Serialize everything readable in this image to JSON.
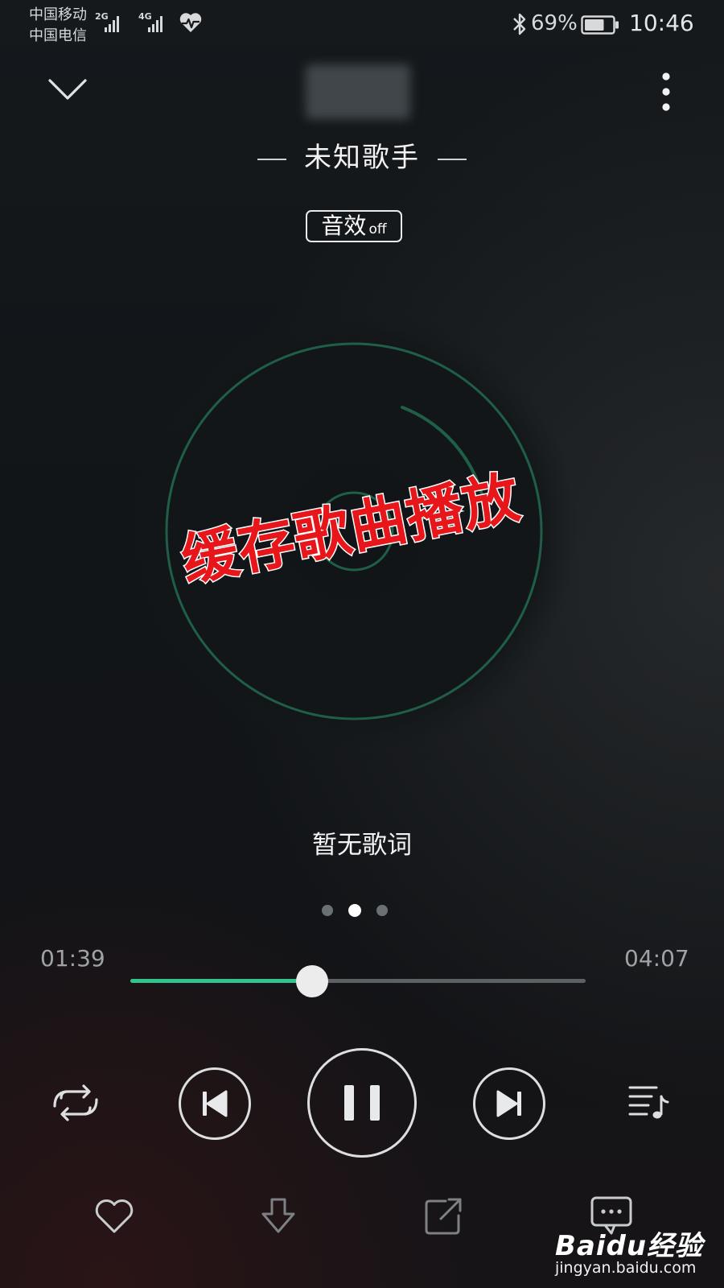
{
  "status_bar": {
    "carrier_1": "中国移动",
    "carrier_2": "中国电信",
    "signal_1_tag": "2G",
    "signal_2_tag": "4G",
    "battery_percent": "69%",
    "battery_level": 0.69,
    "time": "10:46",
    "icons": [
      "signal-2g-icon",
      "signal-4g-icon",
      "heart-rate-icon",
      "bluetooth-icon",
      "battery-icon"
    ]
  },
  "header": {
    "artist": "未知歌手",
    "sound_effect_label": "音效",
    "sound_effect_state": "off",
    "icons": [
      "chevron-down-icon",
      "more-vertical-icon"
    ]
  },
  "overlay": {
    "caption": "缓存歌曲播放"
  },
  "lyrics": {
    "text": "暂无歌词"
  },
  "pager": {
    "count": 3,
    "active_index": 1
  },
  "progress": {
    "elapsed": "01:39",
    "duration": "04:07",
    "fraction": 0.4
  },
  "controls": {
    "icons": [
      "repeat-icon",
      "previous-icon",
      "pause-icon",
      "next-icon",
      "playlist-icon"
    ],
    "accent_color": "#31c48d"
  },
  "bottom_bar": {
    "icons": [
      "heart-icon",
      "download-icon",
      "share-icon",
      "comment-icon"
    ]
  },
  "watermark": {
    "brand": "Baidu经验",
    "url": "jingyan.baidu.com"
  }
}
